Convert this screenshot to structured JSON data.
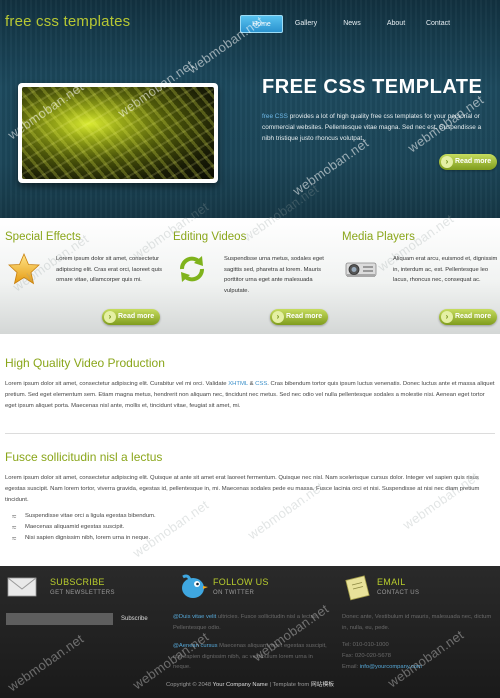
{
  "header": {
    "logo": "free css templates",
    "nav": [
      {
        "label": "Home",
        "active": true
      },
      {
        "label": "Gallery",
        "active": false
      },
      {
        "label": "News",
        "active": false
      },
      {
        "label": "About",
        "active": false
      },
      {
        "label": "Contact",
        "active": false
      }
    ]
  },
  "hero": {
    "title": "FREE CSS TEMPLATE",
    "text_highlight": "free CSS",
    "text": " provides a lot of high quality free css templates for your personal or commercial websites. Pellentesque vitae magna. Sed nec est. Suspendisse a nibh tristique justo rhoncus volutpat.",
    "button": "Read more"
  },
  "features": [
    {
      "title": "Special Effects",
      "icon": "star-icon",
      "text": "Lorem ipsum dolor sit amet, consectetur adipiscing elit. Cras erat orci, laoreet quis ornare vitae, ullamcorper quis mi.",
      "button": "Read more"
    },
    {
      "title": "Editing Videos",
      "icon": "refresh-icon",
      "text": "Suspendisse urna metus, sodales eget sagittis sed, pharetra at lorem. Mauris porttitor urna eget ante malesuada vulputate.",
      "button": "Read more"
    },
    {
      "title": "Media Players",
      "icon": "projector-icon",
      "text": "Aliquam erat arcu, euismod et, dignissim in, interdum ac, est. Pellentesque leo lacus, rhoncus nec, consequat ac.",
      "button": "Read more"
    }
  ],
  "section1": {
    "title": "High Quality Video Production",
    "text_before": "Lorem ipsum dolor sit amet, consectetur adipiscing elit. Curabitur vel mi orci. Validate ",
    "link_xhtml": "XHTML",
    "amp": " & ",
    "link_css": "CSS",
    "text_after": ". Cras bibendum tortor quis ipsum luctus venenatis. Donec luctus ante et massa aliquet pretium. Sed eget elementum sem. Etiam magna metus, hendrerit non aliquam nec, tincidunt nec metus. Sed nec odio vel nulla pellentesque sodales a molestie nisi. Aenean eget tortor eget ipsum aliquet porta. Maecenas nisl ante, mollis et, tincidunt vitae, feugiat sit amet, mi."
  },
  "section2": {
    "title": "Fusce sollicitudin nisl a lectus",
    "text": "Lorem ipsum dolor sit amet, consectetur adipiscing elit. Quisque at ante sit amet erat laoreet fermentum. Quisque nec nisl. Nam scelerisque cursus dolor. Integer vel sapien quis risus egestas suscipit. Nam lorem tortor, viverra gravida, egestas id, pellentesque in, mi. Maecenas sodales pede eu massa. Fusce lacinia orci et nisi. Suspendisse at nisi nec diam pretium tincidunt.",
    "bullets": [
      "Suspendisse vitae orci a ligula egestas bibendum.",
      "Maecenas aliquamid egestas suscipit.",
      "Nisi sapien dignissim nibh, lorem urna in neque."
    ]
  },
  "footer": {
    "subscribe": {
      "title": "SUBSCRIBE",
      "subtitle": "GET NEWSLETTERS",
      "button": "Subscribe"
    },
    "follow": {
      "title": "FOLLOW US",
      "subtitle": "ON TWITTER",
      "tweets": [
        {
          "user": "@Duis vitae velit",
          "text": " ultricies. Fusce sollicitudin nisl a lectus. Pellentesque odio."
        },
        {
          "user": "@Aenean cursus",
          "text": " Maecenas aliquam, eget egestas suscipit, nisi sapien dignissim nibh, ac vestibulum lorem urna in neque."
        }
      ]
    },
    "email": {
      "title": "EMAIL",
      "subtitle": "CONTACT US",
      "address": "Donec ante, Vestibulum id mauris, malesuada nec, dictum in, nulla, eu, pede.",
      "tel": "Tel: 010-010-1000",
      "fax": "Fax: 020-020-5678",
      "email_label": "Email: ",
      "email": "info@yourcompany.com"
    },
    "copyright_pre": "Copyright © 2048 ",
    "company": "Your Company Name",
    "copyright_mid": " | Template from ",
    "template_source": "网站模板"
  },
  "watermark": "webmoban.net"
}
